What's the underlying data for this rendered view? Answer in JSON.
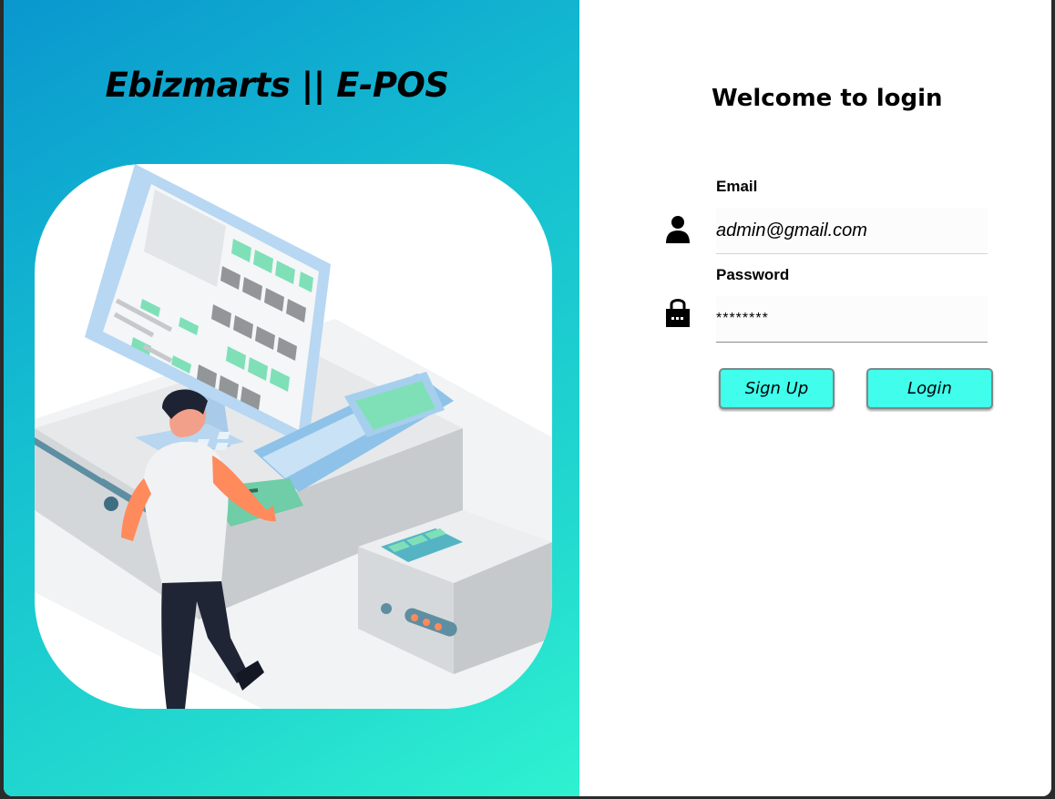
{
  "brand": {
    "title": "Ebizmarts || E-POS"
  },
  "login": {
    "heading": "Welcome to login",
    "email_label": "Email",
    "email_value": "admin@gmail.com",
    "password_label": "Password",
    "password_value": "********",
    "signup_label": "Sign Up",
    "login_label": "Login"
  },
  "icons": {
    "email": "user-icon",
    "password": "lock-icon",
    "illustration": "pos-terminal-illustration"
  },
  "colors": {
    "gradient_start": "#0a97cf",
    "gradient_end": "#2ff2d0",
    "button_bg": "#40fdec"
  }
}
